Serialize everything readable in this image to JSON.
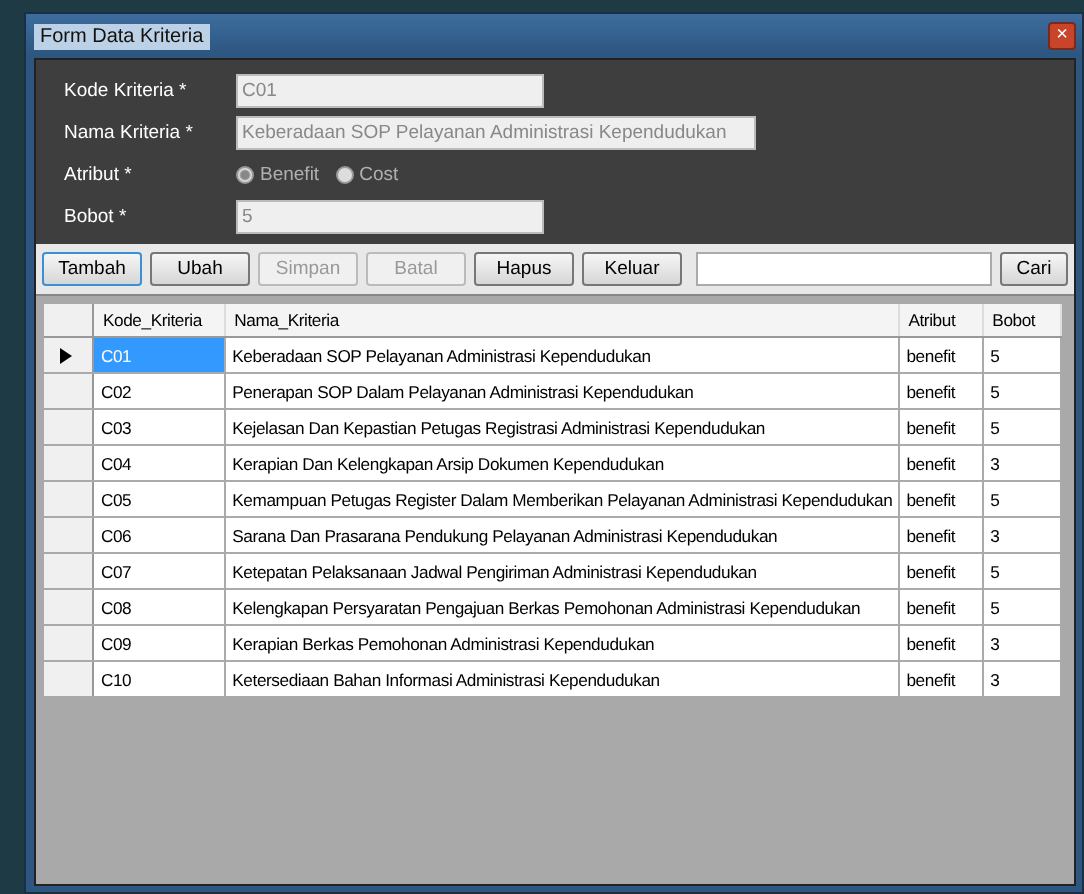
{
  "window": {
    "title": "Form Data Kriteria",
    "close_button": "×"
  },
  "form": {
    "fields": [
      {
        "label": "Kode Kriteria *",
        "kind": "text",
        "value": "C01",
        "wide": false
      },
      {
        "label": "Nama Kriteria *",
        "kind": "text",
        "value": "Keberadaan SOP Pelayanan Administrasi Kependudukan",
        "wide": true
      },
      {
        "label": "Atribut *",
        "kind": "radio",
        "options": [
          {
            "label": "Benefit",
            "selected": true
          },
          {
            "label": "Cost",
            "selected": false
          }
        ]
      },
      {
        "label": "Bobot *",
        "kind": "text",
        "value": "5",
        "wide": false
      }
    ]
  },
  "toolbar": {
    "buttons": [
      {
        "label": "Tambah",
        "disabled": false,
        "focused": true
      },
      {
        "label": "Ubah",
        "disabled": false,
        "focused": false
      },
      {
        "label": "Simpan",
        "disabled": true,
        "focused": false
      },
      {
        "label": "Batal",
        "disabled": true,
        "focused": false
      },
      {
        "label": "Hapus",
        "disabled": false,
        "focused": false
      },
      {
        "label": "Keluar",
        "disabled": false,
        "focused": false
      }
    ],
    "search_button": "Cari"
  },
  "table": {
    "columns": [
      "Kode_Kriteria",
      "Nama_Kriteria",
      "Atribut",
      "Bobot"
    ],
    "rows": [
      {
        "cells": [
          "C01",
          "Keberadaan SOP Pelayanan Administrasi Kependudukan",
          "benefit",
          "5"
        ],
        "selected": true
      },
      {
        "cells": [
          "C02",
          "Penerapan SOP Dalam Pelayanan Administrasi Kependudukan",
          "benefit",
          "5"
        ],
        "selected": false
      },
      {
        "cells": [
          "C03",
          "Kejelasan Dan Kepastian Petugas Registrasi Administrasi Kependudukan",
          "benefit",
          "5"
        ],
        "selected": false
      },
      {
        "cells": [
          "C04",
          "Kerapian Dan Kelengkapan Arsip Dokumen Kependudukan",
          "benefit",
          "3"
        ],
        "selected": false
      },
      {
        "cells": [
          "C05",
          "Kemampuan Petugas Register Dalam Memberikan Pelayanan Administrasi Kependudukan",
          "benefit",
          "5"
        ],
        "selected": false
      },
      {
        "cells": [
          "C06",
          "Sarana Dan Prasarana Pendukung Pelayanan Administrasi Kependudukan",
          "benefit",
          "3"
        ],
        "selected": false
      },
      {
        "cells": [
          "C07",
          "Ketepatan Pelaksanaan Jadwal Pengiriman Administrasi Kependudukan",
          "benefit",
          "5"
        ],
        "selected": false
      },
      {
        "cells": [
          "C08",
          "Kelengkapan Persyaratan Pengajuan Berkas Pemohonan Administrasi Kependudukan",
          "benefit",
          "5"
        ],
        "selected": false
      },
      {
        "cells": [
          "C09",
          "Kerapian Berkas Pemohonan Administrasi Kependudukan",
          "benefit",
          "3"
        ],
        "selected": false
      },
      {
        "cells": [
          "C10",
          "Ketersediaan Bahan Informasi Administrasi Kependudukan",
          "benefit",
          "3"
        ],
        "selected": false
      }
    ]
  }
}
